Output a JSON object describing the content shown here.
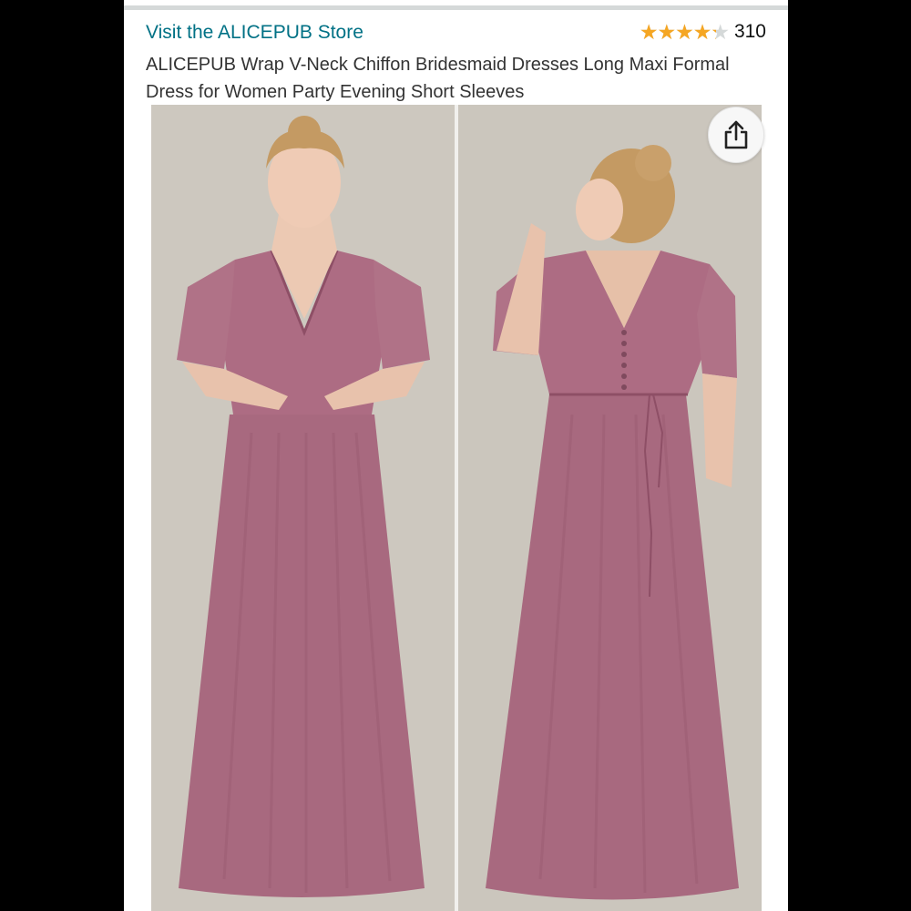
{
  "store": {
    "link_text": "Visit the ALICEPUB Store"
  },
  "rating": {
    "stars": 4.3,
    "max": 5,
    "count": "310",
    "star_glyphs": "★★★★★"
  },
  "product": {
    "title": "ALICEPUB Wrap V-Neck Chiffon Bridesmaid Dresses Long Maxi Formal Dress for Women Party Evening Short Sleeves"
  },
  "gallery": {
    "images": [
      {
        "name": "front-view"
      },
      {
        "name": "back-view"
      }
    ]
  },
  "icons": {
    "share": "share-icon"
  },
  "colors": {
    "link": "#007185",
    "star": "#f5a623",
    "dress": "#a8697f",
    "backdrop": "#cbc6bd"
  }
}
